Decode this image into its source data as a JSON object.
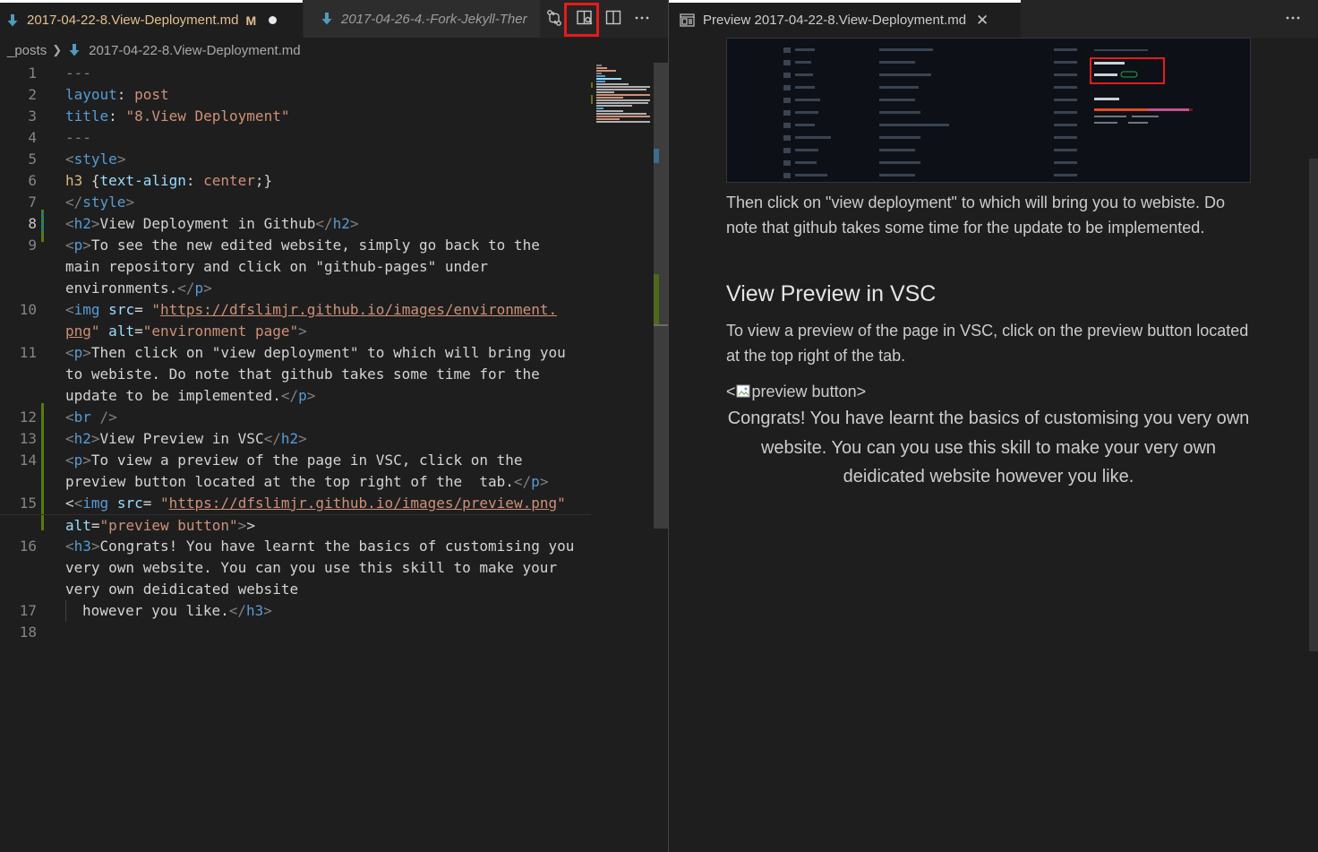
{
  "editor": {
    "active_tab": {
      "name": "2017-04-22-8.View-Deployment.md",
      "status": "M"
    },
    "second_tab": {
      "name": "2017-04-26-4.-Fork-Jekyll-Ther"
    },
    "breadcrumb": {
      "folder": "_posts",
      "file": "2017-04-22-8.View-Deployment.md"
    },
    "actions": [
      "git-compare-icon",
      "open-preview-to-side-icon",
      "split-editor-icon",
      "more-actions-icon"
    ],
    "line_numbers": [
      "1",
      "2",
      "3",
      "4",
      "5",
      "6",
      "7",
      "8",
      "9",
      "10",
      "11",
      "12",
      "13",
      "14",
      "15",
      "16",
      "17",
      "18"
    ],
    "lines": {
      "l1": "---",
      "l2_key": "layout",
      "l2_colon": ": ",
      "l2_val": "post",
      "l3_key": "title",
      "l3_colon": ": ",
      "l3_val": "\"8.View Deployment\"",
      "l4": "---",
      "l5_open": "<",
      "l5_tag": "style",
      "l5_close": ">",
      "l6_sel": "h3",
      "l6_b1": " {",
      "l6_prop": "text-align",
      "l6_colon": ": ",
      "l6_val": "center",
      "l6_b2": ";}",
      "l7_open": "</",
      "l7_tag": "style",
      "l7_close": ">",
      "l8_open": "<",
      "l8_tag": "h2",
      "l8_close": ">",
      "l8_text": "View Deployment in Github",
      "l8_eopen": "</",
      "l8_etag": "h2",
      "l8_eclose": ">",
      "l9a_open": "<",
      "l9a_tag": "p",
      "l9a_close": ">",
      "l9a_text": "To see the new edited website, simply go back to the",
      "l9b_text": "main repository and click on \"github-pages\" under",
      "l9c_text": "environments.",
      "l9c_eopen": "</",
      "l9c_etag": "p",
      "l9c_eclose": ">",
      "l10a_open": "<",
      "l10a_tag": "img",
      "l10a_attr": " src",
      "l10a_eq": "= ",
      "l10a_q": "\"",
      "l10a_url": "https://dfslimjr.github.io/images/environment.",
      "l10b_url": "png",
      "l10b_q": "\"",
      "l10b_attr": " alt",
      "l10b_eq": "=",
      "l10b_val": "\"environment page\"",
      "l10b_close": ">",
      "l11a_open": "<",
      "l11a_tag": "p",
      "l11a_close": ">",
      "l11a_text": "Then click on \"view deployment\" to which will bring you",
      "l11b_text": "to webiste. Do note that github takes some time for the",
      "l11c_text": "update to be implemented.",
      "l11c_eopen": "</",
      "l11c_etag": "p",
      "l11c_eclose": ">",
      "l12_open": "<",
      "l12_tag": "br",
      "l12_close": " />",
      "l13_open": "<",
      "l13_tag": "h2",
      "l13_close": ">",
      "l13_text": "View Preview in VSC",
      "l13_eopen": "</",
      "l13_etag": "h2",
      "l13_eclose": ">",
      "l14a_open": "<",
      "l14a_tag": "p",
      "l14a_close": ">",
      "l14a_text": "To view a preview of the page in VSC, click on the",
      "l14b_text": "preview button located at the top right of the  tab.",
      "l14b_eopen": "</",
      "l14b_etag": "p",
      "l14b_eclose": ">",
      "l15a_lt": "<",
      "l15a_open": "<",
      "l15a_tag": "img",
      "l15a_attr": " src",
      "l15a_eq": "= ",
      "l15a_q1": "\"",
      "l15a_url": "https://dfslimjr.github.io/images/preview.png",
      "l15a_q2": "\"",
      "l15b_attr": "alt",
      "l15b_eq": "=",
      "l15b_val": "\"preview button\"",
      "l15b_close": ">",
      "l15b_gt": ">",
      "l16a_open": "<",
      "l16a_tag": "h3",
      "l16a_close": ">",
      "l16a_text": "Congrats! You have learnt the basics of customising you",
      "l16b_text": "very own website. You can you use this skill to make your",
      "l16c_text": "very own deidicated website",
      "l17_text": "however you like.",
      "l17_eopen": "</",
      "l17_etag": "h3",
      "l17_eclose": ">"
    }
  },
  "preview": {
    "tab_title": "Preview 2017-04-22-8.View-Deployment.md",
    "para_deploy": "Then click on \"view deployment\" to which will bring you to webiste. Do note that github takes some time for the update to be implemented.",
    "h2_vsc": "View Preview in VSC",
    "para_vsc": "To view a preview of the page in VSC, click on the preview button located at the top right of the tab.",
    "img_lt": "<",
    "img_alt": "preview button>",
    "h3_congrats": "Congrats! You have learnt the basics of customising you very own website. You can you use this skill to make your very own deidicated website however you like."
  },
  "colors": {
    "highlight_box": "#e51c1c",
    "modified": "#e2c08d",
    "added_gutter": "#587c0c",
    "modified_gutter": "#0c7d9d"
  }
}
